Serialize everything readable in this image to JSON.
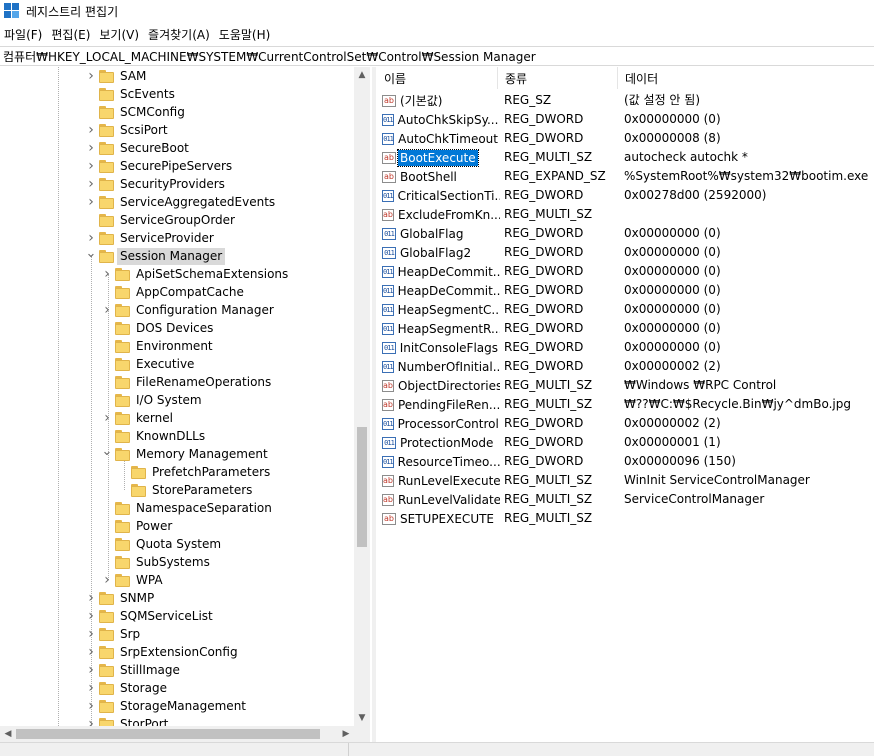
{
  "window": {
    "title": "레지스트리 편집기"
  },
  "menu": [
    "파일(F)",
    "편집(E)",
    "보기(V)",
    "즐겨찾기(A)",
    "도움말(H)"
  ],
  "address": "컴퓨터₩HKEY_LOCAL_MACHINE₩SYSTEM₩CurrentControlSet₩Control₩Session Manager",
  "tree": [
    {
      "label": "SAM",
      "expander": "collapsed"
    },
    {
      "label": "ScEvents",
      "expander": "none"
    },
    {
      "label": "SCMConfig",
      "expander": "none"
    },
    {
      "label": "ScsiPort",
      "expander": "collapsed"
    },
    {
      "label": "SecureBoot",
      "expander": "collapsed"
    },
    {
      "label": "SecurePipeServers",
      "expander": "collapsed"
    },
    {
      "label": "SecurityProviders",
      "expander": "collapsed"
    },
    {
      "label": "ServiceAggregatedEvents",
      "expander": "collapsed"
    },
    {
      "label": "ServiceGroupOrder",
      "expander": "none"
    },
    {
      "label": "ServiceProvider",
      "expander": "collapsed"
    },
    {
      "label": "Session Manager",
      "expander": "expanded",
      "selected": true
    },
    {
      "label": "ApiSetSchemaExtensions",
      "expander": "collapsed"
    },
    {
      "label": "AppCompatCache",
      "expander": "none"
    },
    {
      "label": "Configuration Manager",
      "expander": "collapsed"
    },
    {
      "label": "DOS Devices",
      "expander": "none"
    },
    {
      "label": "Environment",
      "expander": "none"
    },
    {
      "label": "Executive",
      "expander": "none"
    },
    {
      "label": "FileRenameOperations",
      "expander": "none"
    },
    {
      "label": "I/O System",
      "expander": "none"
    },
    {
      "label": "kernel",
      "expander": "collapsed"
    },
    {
      "label": "KnownDLLs",
      "expander": "none"
    },
    {
      "label": "Memory Management",
      "expander": "expanded"
    },
    {
      "label": "PrefetchParameters",
      "expander": "none"
    },
    {
      "label": "StoreParameters",
      "expander": "none"
    },
    {
      "label": "NamespaceSeparation",
      "expander": "none"
    },
    {
      "label": "Power",
      "expander": "none"
    },
    {
      "label": "Quota System",
      "expander": "none"
    },
    {
      "label": "SubSystems",
      "expander": "none"
    },
    {
      "label": "WPA",
      "expander": "collapsed"
    },
    {
      "label": "SNMP",
      "expander": "collapsed"
    },
    {
      "label": "SQMServiceList",
      "expander": "collapsed"
    },
    {
      "label": "Srp",
      "expander": "collapsed"
    },
    {
      "label": "SrpExtensionConfig",
      "expander": "collapsed"
    },
    {
      "label": "StillImage",
      "expander": "collapsed"
    },
    {
      "label": "Storage",
      "expander": "collapsed"
    },
    {
      "label": "StorageManagement",
      "expander": "collapsed"
    },
    {
      "label": "StorPort",
      "expander": "collapsed"
    }
  ],
  "columns": [
    "이름",
    "종류",
    "데이터"
  ],
  "values": [
    {
      "name": "(기본값)",
      "type": "REG_SZ",
      "data": "(값 설정 안 됨)",
      "icon": "string-value-icon"
    },
    {
      "name": "AutoChkSkipSy...",
      "type": "REG_DWORD",
      "data": "0x00000000 (0)",
      "icon": "binary-value-icon"
    },
    {
      "name": "AutoChkTimeout",
      "type": "REG_DWORD",
      "data": "0x00000008 (8)",
      "icon": "binary-value-icon"
    },
    {
      "name": "BootExecute",
      "type": "REG_MULTI_SZ",
      "data": "autocheck autochk *",
      "icon": "string-value-icon",
      "selected": true
    },
    {
      "name": "BootShell",
      "type": "REG_EXPAND_SZ",
      "data": "%SystemRoot%₩system32₩bootim.exe",
      "icon": "string-value-icon"
    },
    {
      "name": "CriticalSectionTi...",
      "type": "REG_DWORD",
      "data": "0x00278d00 (2592000)",
      "icon": "binary-value-icon"
    },
    {
      "name": "ExcludeFromKn...",
      "type": "REG_MULTI_SZ",
      "data": "",
      "icon": "string-value-icon"
    },
    {
      "name": "GlobalFlag",
      "type": "REG_DWORD",
      "data": "0x00000000 (0)",
      "icon": "binary-value-icon"
    },
    {
      "name": "GlobalFlag2",
      "type": "REG_DWORD",
      "data": "0x00000000 (0)",
      "icon": "binary-value-icon"
    },
    {
      "name": "HeapDeCommit...",
      "type": "REG_DWORD",
      "data": "0x00000000 (0)",
      "icon": "binary-value-icon"
    },
    {
      "name": "HeapDeCommit...",
      "type": "REG_DWORD",
      "data": "0x00000000 (0)",
      "icon": "binary-value-icon"
    },
    {
      "name": "HeapSegmentC...",
      "type": "REG_DWORD",
      "data": "0x00000000 (0)",
      "icon": "binary-value-icon"
    },
    {
      "name": "HeapSegmentR...",
      "type": "REG_DWORD",
      "data": "0x00000000 (0)",
      "icon": "binary-value-icon"
    },
    {
      "name": "InitConsoleFlags",
      "type": "REG_DWORD",
      "data": "0x00000000 (0)",
      "icon": "binary-value-icon"
    },
    {
      "name": "NumberOfInitial...",
      "type": "REG_DWORD",
      "data": "0x00000002 (2)",
      "icon": "binary-value-icon"
    },
    {
      "name": "ObjectDirectories",
      "type": "REG_MULTI_SZ",
      "data": "₩Windows ₩RPC Control",
      "icon": "string-value-icon"
    },
    {
      "name": "PendingFileRen...",
      "type": "REG_MULTI_SZ",
      "data": "₩??₩C:₩$Recycle.Bin₩jy^dmBo.jpg",
      "icon": "string-value-icon"
    },
    {
      "name": "ProcessorControl",
      "type": "REG_DWORD",
      "data": "0x00000002 (2)",
      "icon": "binary-value-icon"
    },
    {
      "name": "ProtectionMode",
      "type": "REG_DWORD",
      "data": "0x00000001 (1)",
      "icon": "binary-value-icon"
    },
    {
      "name": "ResourceTimeo...",
      "type": "REG_DWORD",
      "data": "0x00000096 (150)",
      "icon": "binary-value-icon"
    },
    {
      "name": "RunLevelExecute",
      "type": "REG_MULTI_SZ",
      "data": "WinInit ServiceControlManager",
      "icon": "string-value-icon"
    },
    {
      "name": "RunLevelValidate",
      "type": "REG_MULTI_SZ",
      "data": "ServiceControlManager",
      "icon": "string-value-icon"
    },
    {
      "name": "SETUPEXECUTE",
      "type": "REG_MULTI_SZ",
      "data": "",
      "icon": "string-value-icon"
    }
  ],
  "glyphs": {
    "string": "ab",
    "binary": "011"
  }
}
